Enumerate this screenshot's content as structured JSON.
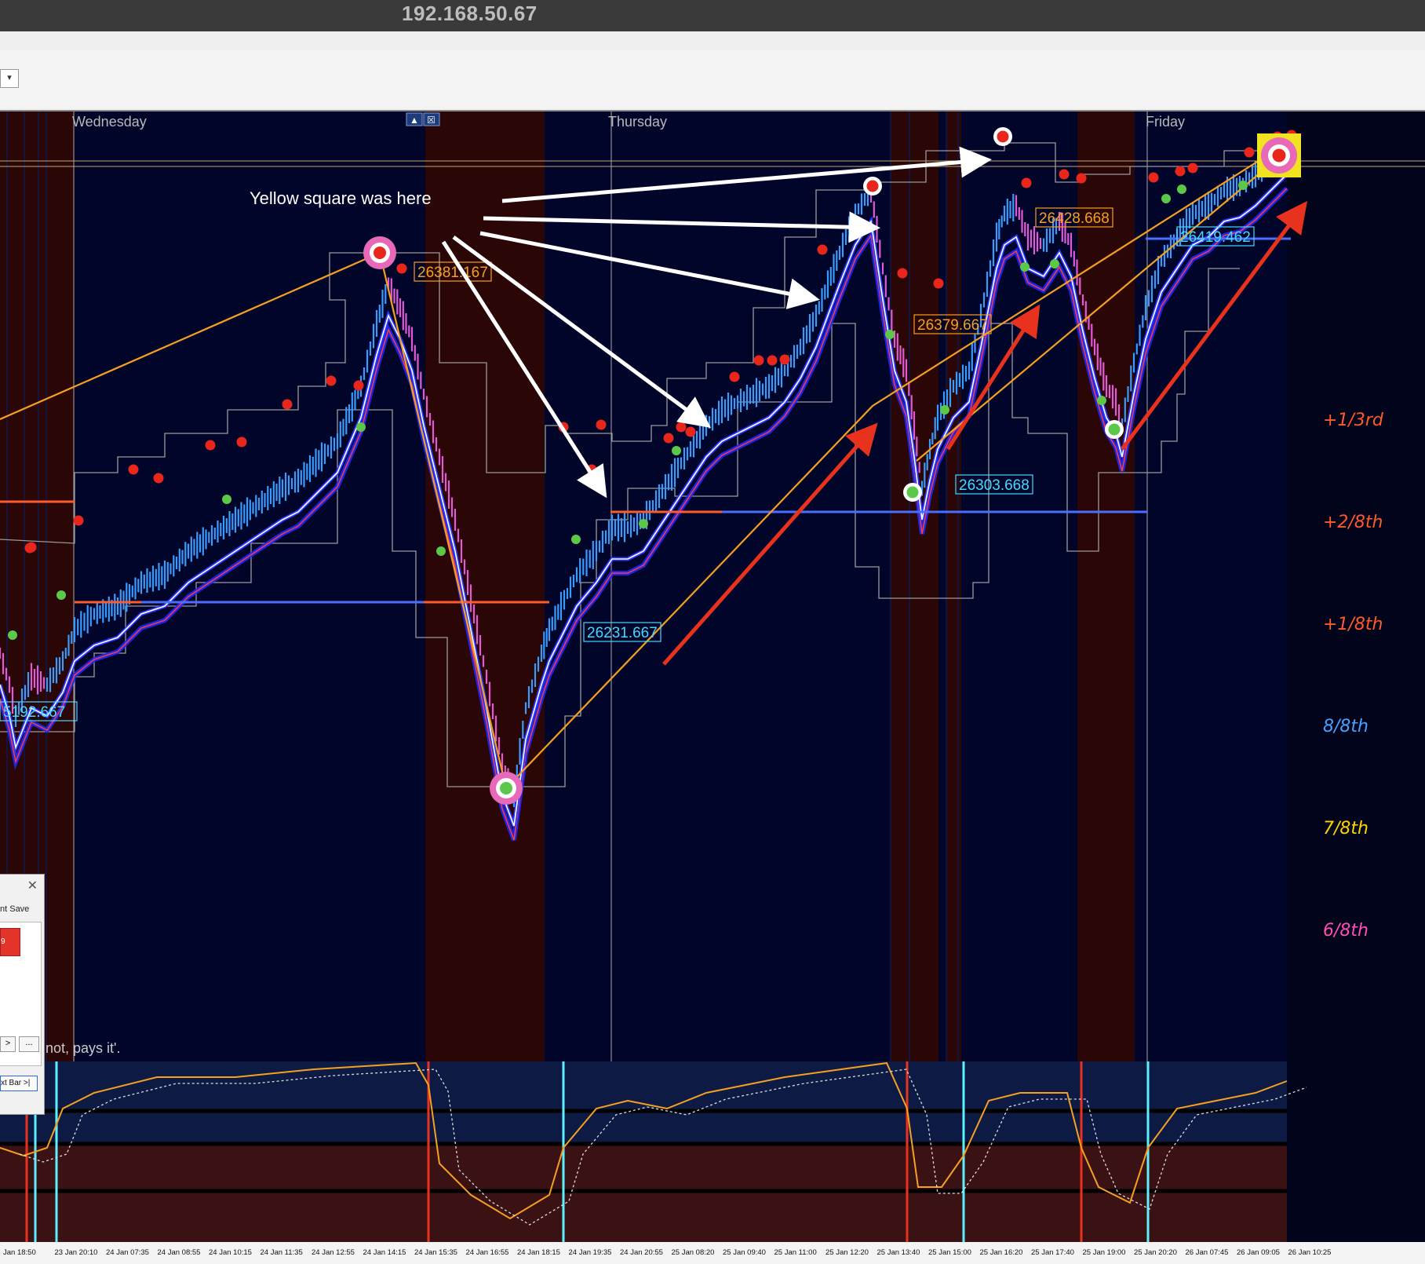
{
  "window": {
    "title": "192.168.50.67"
  },
  "toolbar": {
    "button_glyph": "▾"
  },
  "chart": {
    "day_labels": [
      "Wednesday",
      "Thursday",
      "Friday"
    ],
    "annotation": "Yellow square was here",
    "price_labels": [
      "26381.167",
      "26231.667",
      "26379.667",
      "26303.668",
      "26428.668",
      "26419.462",
      "5192.667"
    ],
    "fraction_labels": [
      {
        "text": "+1/3rd",
        "color": "#ff5a2a"
      },
      {
        "text": "+2/8th",
        "color": "#ff5a2a"
      },
      {
        "text": "+1/8th",
        "color": "#ff5a2a"
      },
      {
        "text": "8/8th",
        "color": "#4aa0ff"
      },
      {
        "text": "7/8th",
        "color": "#ffd400"
      },
      {
        "text": "6/8th",
        "color": "#ff4fb0"
      }
    ],
    "time_labels": [
      "Jan 18:50",
      "23 Jan 20:10",
      "24 Jan 07:35",
      "24 Jan 08:55",
      "24 Jan 10:15",
      "24 Jan 11:35",
      "24 Jan 12:55",
      "24 Jan 14:15",
      "24 Jan 15:35",
      "24 Jan 16:55",
      "24 Jan 18:15",
      "24 Jan 19:35",
      "24 Jan 20:55",
      "25 Jan 08:20",
      "25 Jan 09:40",
      "25 Jan 11:00",
      "25 Jan 12:20",
      "25 Jan 13:40",
      "25 Jan 15:00",
      "25 Jan 16:20",
      "25 Jan 17:40",
      "25 Jan 19:00",
      "25 Jan 20:20",
      "26 Jan 07:45",
      "26 Jan 09:05",
      "26 Jan 10:25"
    ],
    "colors": {
      "background": "#02052a",
      "session": "#2a0606",
      "up": "#3a9bff",
      "down": "#e25ad8",
      "ema_fast": "#ffffff",
      "ema_slow": "#ff3b3b",
      "zigzag": "#f5a020",
      "arrow_red": "#e8321e"
    },
    "panel_buttons": [
      "▲",
      "☒"
    ]
  },
  "dialog": {
    "save_label": "nt  Save",
    "value": "9",
    "btn_a": ">",
    "btn_b": "...",
    "next_bar": "xt Bar >|",
    "close": "✕"
  },
  "footer_note": "not, pays it'."
}
